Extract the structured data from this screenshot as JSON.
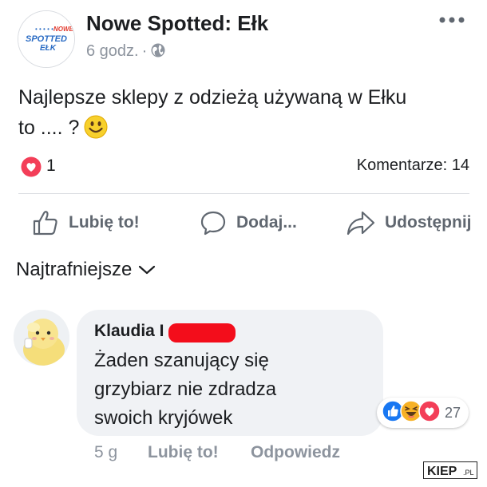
{
  "post": {
    "page_name": "Nowe Spotted: Ełk",
    "time": "6 godz.",
    "separator": "·",
    "text_line1": "Najlepsze sklepy z odzieżą używaną w Ełku",
    "text_line2": "to .... ?",
    "reactions_count": "1",
    "comments_label": "Komentarze: 14",
    "avatar_logo": {
      "top": "NOWE",
      "middle": "SPOTTED",
      "bottom": "EŁK"
    }
  },
  "actions": {
    "like": "Lubię to!",
    "comment": "Dodaj...",
    "share": "Udostępnij"
  },
  "sort_label": "Najtrafniejsze",
  "comment": {
    "author": "Klaudia I",
    "text_line1": "Żaden szanujący się",
    "text_line2": "grzybiarz nie zdradza",
    "text_line3": "swoich kryjówek",
    "reactions_count": "27",
    "time": "5 g",
    "like": "Lubię to!",
    "reply": "Odpowiedz"
  },
  "watermark": "KIEP.PL",
  "colors": {
    "heart": "#f33e58",
    "like_blue": "#1877f2",
    "haha_yellow": "#f7b125",
    "redaction": "#f30d1b",
    "muted_text": "#8d949e"
  }
}
